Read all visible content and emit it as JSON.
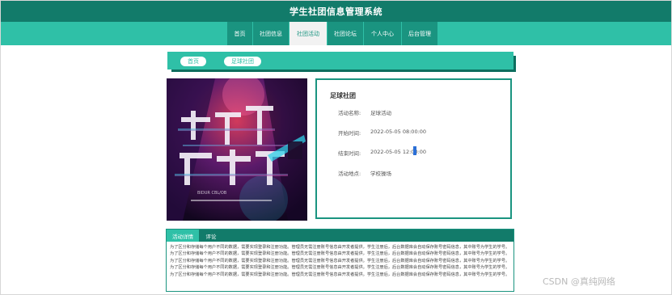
{
  "app": {
    "title": "学生社团信息管理系统"
  },
  "nav": {
    "items": [
      {
        "label": "首页"
      },
      {
        "label": "社团信息"
      },
      {
        "label": "社团活动"
      },
      {
        "label": "社团论坛"
      },
      {
        "label": "个人中心"
      },
      {
        "label": "后台管理"
      }
    ],
    "active_index": 2
  },
  "breadcrumb": {
    "items": [
      {
        "label": "首页"
      },
      {
        "label": "足球社团"
      }
    ]
  },
  "poster": {
    "alt_text": "这就是街舞",
    "caption": "BIDUR CBL/OB"
  },
  "detail": {
    "title": "足球社团",
    "fields": [
      {
        "label": "活动名称:",
        "value": "足球活动"
      },
      {
        "label": "开始时间:",
        "value": "2022-05-05 08:00:00"
      },
      {
        "label": "结束时间:",
        "value": "2022-05-05 12:00:00"
      },
      {
        "label": "活动地点:",
        "value": "学校操场"
      }
    ]
  },
  "tabs": {
    "items": [
      {
        "label": "活动详情"
      },
      {
        "label": "评论"
      }
    ],
    "active_index": 0,
    "content": "为了区分和存储每个用户不同的数据，需要实现登录和注册功能。管理员无需注册账号信息由开发者提供，学生注册后，后台数据库会自动保存账号密码信息，其中账号为学生的学号。为了区分和存储每个用户不同的数据，需要实现登录和注册功能。管理员无需注册账号信息由开发者提供，学生注册后，后台数据库会自动保存账号密码信息，其中账号为学生的学号。为了区分和存储每个用户不同的数据，需要实现登录和注册功能。管理员无需注册账号信息由开发者提供。学生注册后，后台数据库会自动保存账号密码信息，其中账号为学生的学号。为了区分和存储每个用户不同的数据，需要实现登录和注册功能。管理员无需注册账号信息由开发者提供。学生注册后，后台数据库会自动保存账号密码信息，其中账号为学生的学号。为了区分和存储每个用户不同的数据，需要实现登录和注册功能。管理员无需注册账号信息由开发者提供。学生注册后，后台数据库会自动保存账号密码信息，其中账号为学生的学号。"
  },
  "watermark": {
    "text": "CSDN @真纯网络"
  },
  "colors": {
    "primary": "#1a9480",
    "header": "#127b6a",
    "accent": "#2fc0a7"
  }
}
